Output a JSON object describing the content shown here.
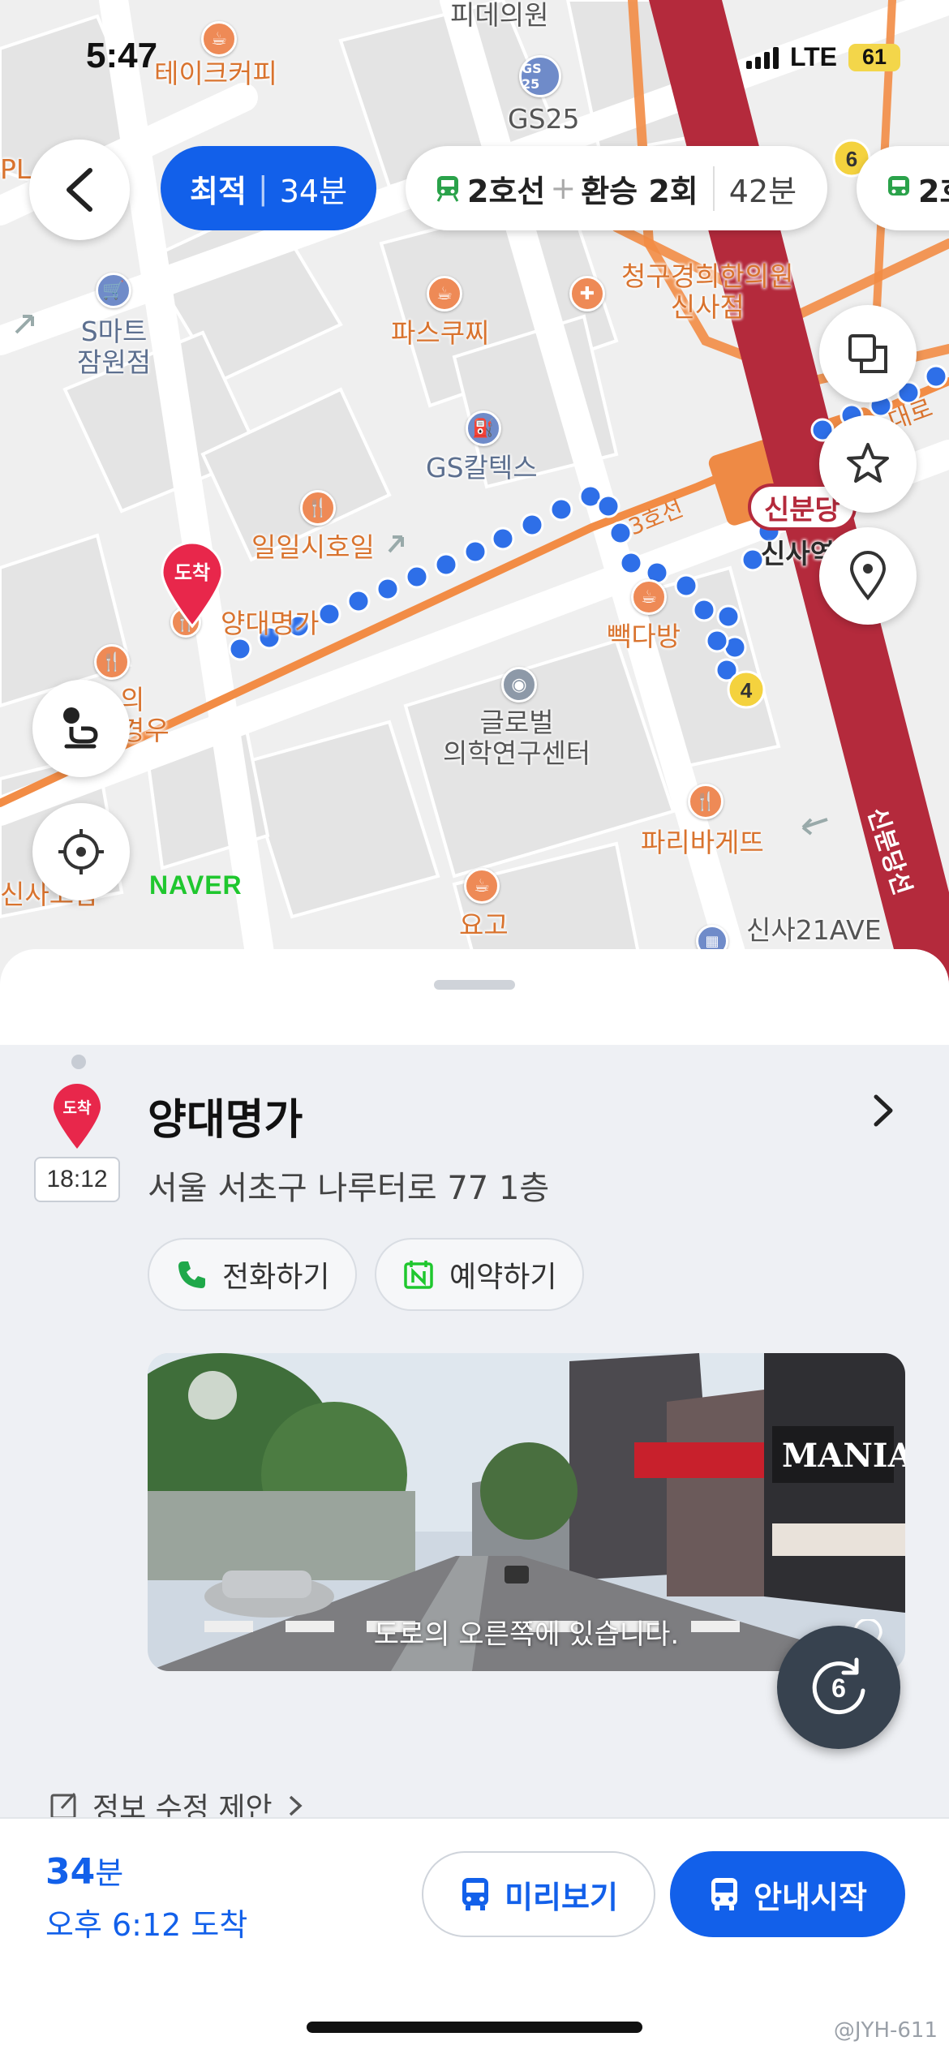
{
  "status_bar": {
    "time": "5:47",
    "network": "LTE",
    "battery": "61"
  },
  "route_options": {
    "active": {
      "label": "최적",
      "time": "34분"
    },
    "option2": {
      "line": "2호선",
      "plus": "+",
      "transfer": "환승 2회",
      "time": "42분"
    },
    "option3": {
      "line": "2호"
    }
  },
  "map": {
    "pois": {
      "takecoffee": "테이크커피",
      "gs25": "GS25",
      "gs25_badge": "GS 25",
      "smart": "S마트",
      "smart2": "잠원점",
      "paskucci": "파스쿠찌",
      "gs_caltex": "GS칼텍스",
      "clinic": "청구경희한의원",
      "clinic2": "신사점",
      "ilil": "일일시호일",
      "dest_label": "양대명가",
      "line3": "3호선",
      "sinbundang": "신분당",
      "sinsa": "신사역",
      "bbaek": "빽다방",
      "global": "글로벌",
      "global2": "의학연구센터",
      "paris": "파리바게뜨",
      "yogo": "요고",
      "sinsa21": "신사21AVE",
      "sinbundang_line": "신분당선",
      "exit4": "4",
      "exit6": "6",
      "pl": "PL 식당",
      "daero": "대로",
      "misc_top": "피데의원",
      "misc_left": "의",
      "misc_left2": "경우",
      "misc_left3": "신사고압",
      "dojak": "도착"
    },
    "naver_logo": "NAVER"
  },
  "sheet": {
    "pin_label": "도착",
    "arrival_time": "18:12",
    "place_name": "양대명가",
    "address": "서울 서초구 나루터로 77 1층",
    "call": "전화하기",
    "reserve": "예약하기",
    "streetview_caption": "도로의 오른쪽에 있습니다.",
    "info_edit": "정보 수정 제안",
    "fab_number": "6"
  },
  "bottom": {
    "eta_num": "34",
    "eta_unit": "분",
    "arrival": "오후 6:12 도착",
    "preview": "미리보기",
    "start": "안내시작",
    "watermark": "@JYH-611"
  },
  "colors": {
    "accent": "#1260EA",
    "line2": "#2aa24a",
    "line3": "#F08A3C",
    "sinbundang": "#B42A3C"
  },
  "icons": [
    "back-icon",
    "train-icon",
    "layers-icon",
    "star-icon",
    "location-pin-icon",
    "route-icon",
    "my-location-icon",
    "phone-icon",
    "naver-reserve-icon",
    "chevron-right-icon",
    "bus-icon",
    "refresh-icon",
    "edit-icon"
  ]
}
